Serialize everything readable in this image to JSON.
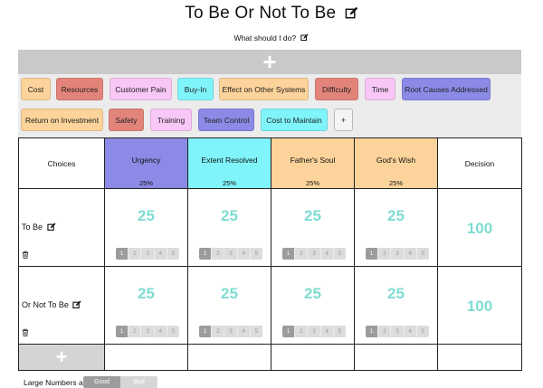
{
  "page": {
    "title": "To Be Or Not To Be",
    "subtitle": "What should I do?",
    "add_criterion_label": "+"
  },
  "tags": [
    {
      "label": "Cost",
      "color": "#fcd39a"
    },
    {
      "label": "Resources",
      "color": "#e3847a"
    },
    {
      "label": "Customer Pain",
      "color": "#f8c7f5"
    },
    {
      "label": "Buy-In",
      "color": "#7ff4fb"
    },
    {
      "label": "Effect on Other Systems",
      "color": "#fcd39a"
    },
    {
      "label": "Difficulty",
      "color": "#e3847a"
    },
    {
      "label": "Time",
      "color": "#f8c7f5"
    },
    {
      "label": "Root Causes Addressed",
      "color": "#8b8ae6"
    },
    {
      "label": "Return on Investment",
      "color": "#fcd39a"
    },
    {
      "label": "Safety",
      "color": "#e3847a"
    },
    {
      "label": "Training",
      "color": "#f8c7f5"
    },
    {
      "label": "Team Control",
      "color": "#8b8ae6"
    },
    {
      "label": "Cost to Maintain",
      "color": "#7ff4fb"
    },
    {
      "label": "+",
      "color": "#f4f4f4"
    }
  ],
  "table": {
    "choices_header": "Choices",
    "decision_header": "Decision",
    "criteria": [
      {
        "name": "Urgency",
        "weight": "25%",
        "color": "#8b8ae6"
      },
      {
        "name": "Extent Resolved",
        "weight": "25%",
        "color": "#7ff4fb"
      },
      {
        "name": "Father's Soul",
        "weight": "25%",
        "color": "#fcd39a"
      },
      {
        "name": "God's Wish",
        "weight": "25%",
        "color": "#fcd39a"
      }
    ],
    "rating_scale": [
      "1",
      "2",
      "3",
      "4",
      "5"
    ],
    "choices": [
      {
        "name": "To Be",
        "scores": [
          "25",
          "25",
          "25",
          "25"
        ],
        "selected_rating": 1,
        "decision": "100"
      },
      {
        "name": "Or Not To Be",
        "scores": [
          "25",
          "25",
          "25",
          "25"
        ],
        "selected_rating": 1,
        "decision": "100"
      }
    ],
    "add_choice_label": "+"
  },
  "footer": {
    "large_numbers_label": "Large Numbers are",
    "good_label": "Good",
    "bad_label": "Bad",
    "selected": "Good"
  },
  "colors": {
    "score_teal": "#7fdcd2",
    "add_bar_grey": "#c9c9c9",
    "tag_area_grey": "#ececec"
  }
}
